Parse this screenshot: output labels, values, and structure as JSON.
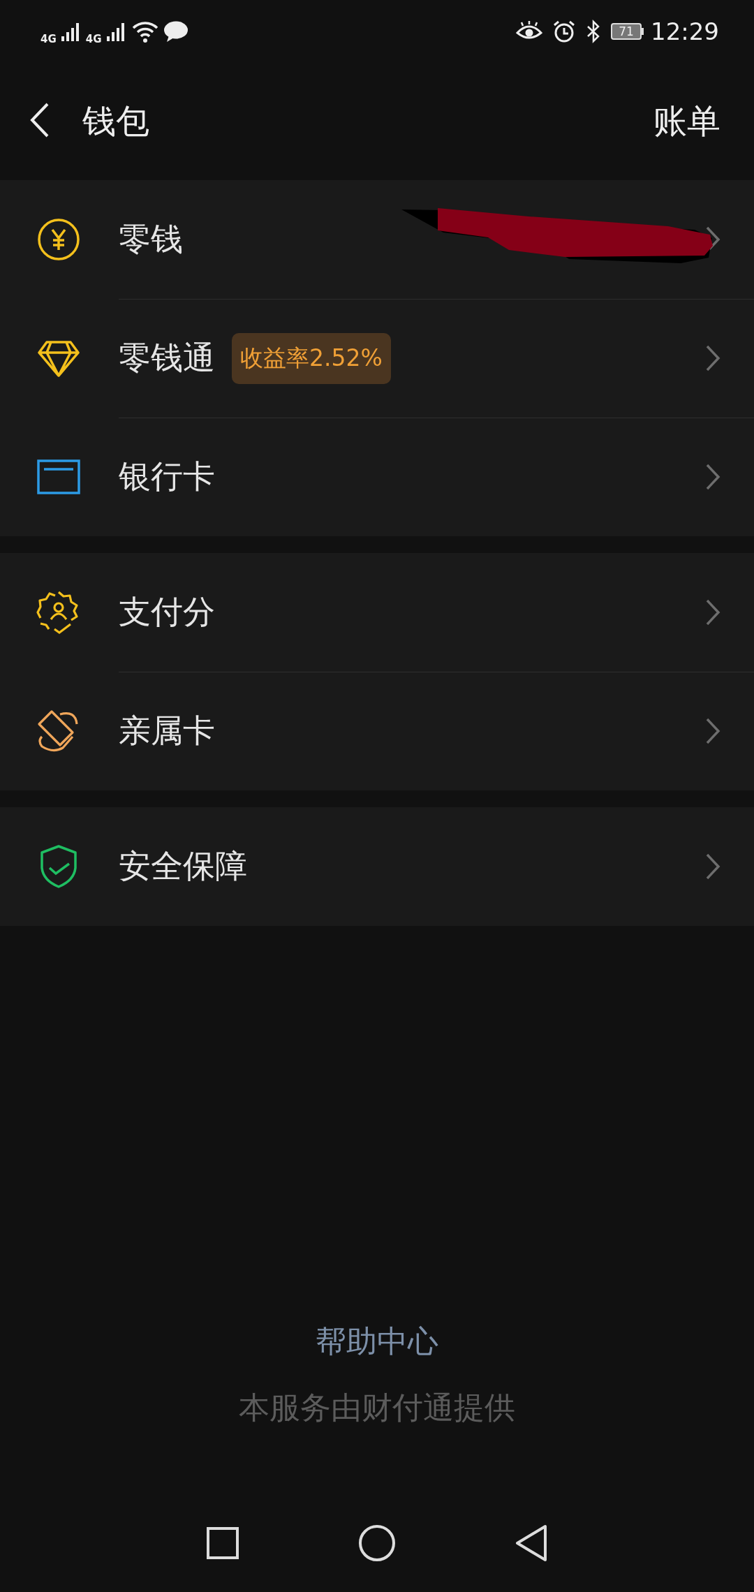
{
  "status_bar": {
    "network_1": "4G",
    "network_2": "4G",
    "battery": "71",
    "time": "12:29"
  },
  "header": {
    "title": "钱包",
    "action": "账单"
  },
  "groups": [
    {
      "items": [
        {
          "kind": "yuan",
          "label": "零钱",
          "redacted": true
        },
        {
          "kind": "diamond",
          "label": "零钱通",
          "badge": "收益率2.52%"
        },
        {
          "kind": "card",
          "label": "银行卡"
        }
      ]
    },
    {
      "items": [
        {
          "kind": "badge",
          "label": "支付分"
        },
        {
          "kind": "family",
          "label": "亲属卡"
        }
      ]
    },
    {
      "items": [
        {
          "kind": "shield",
          "label": "安全保障"
        }
      ]
    }
  ],
  "footer": {
    "help": "帮助中心",
    "provider": "本服务由财付通提供"
  }
}
